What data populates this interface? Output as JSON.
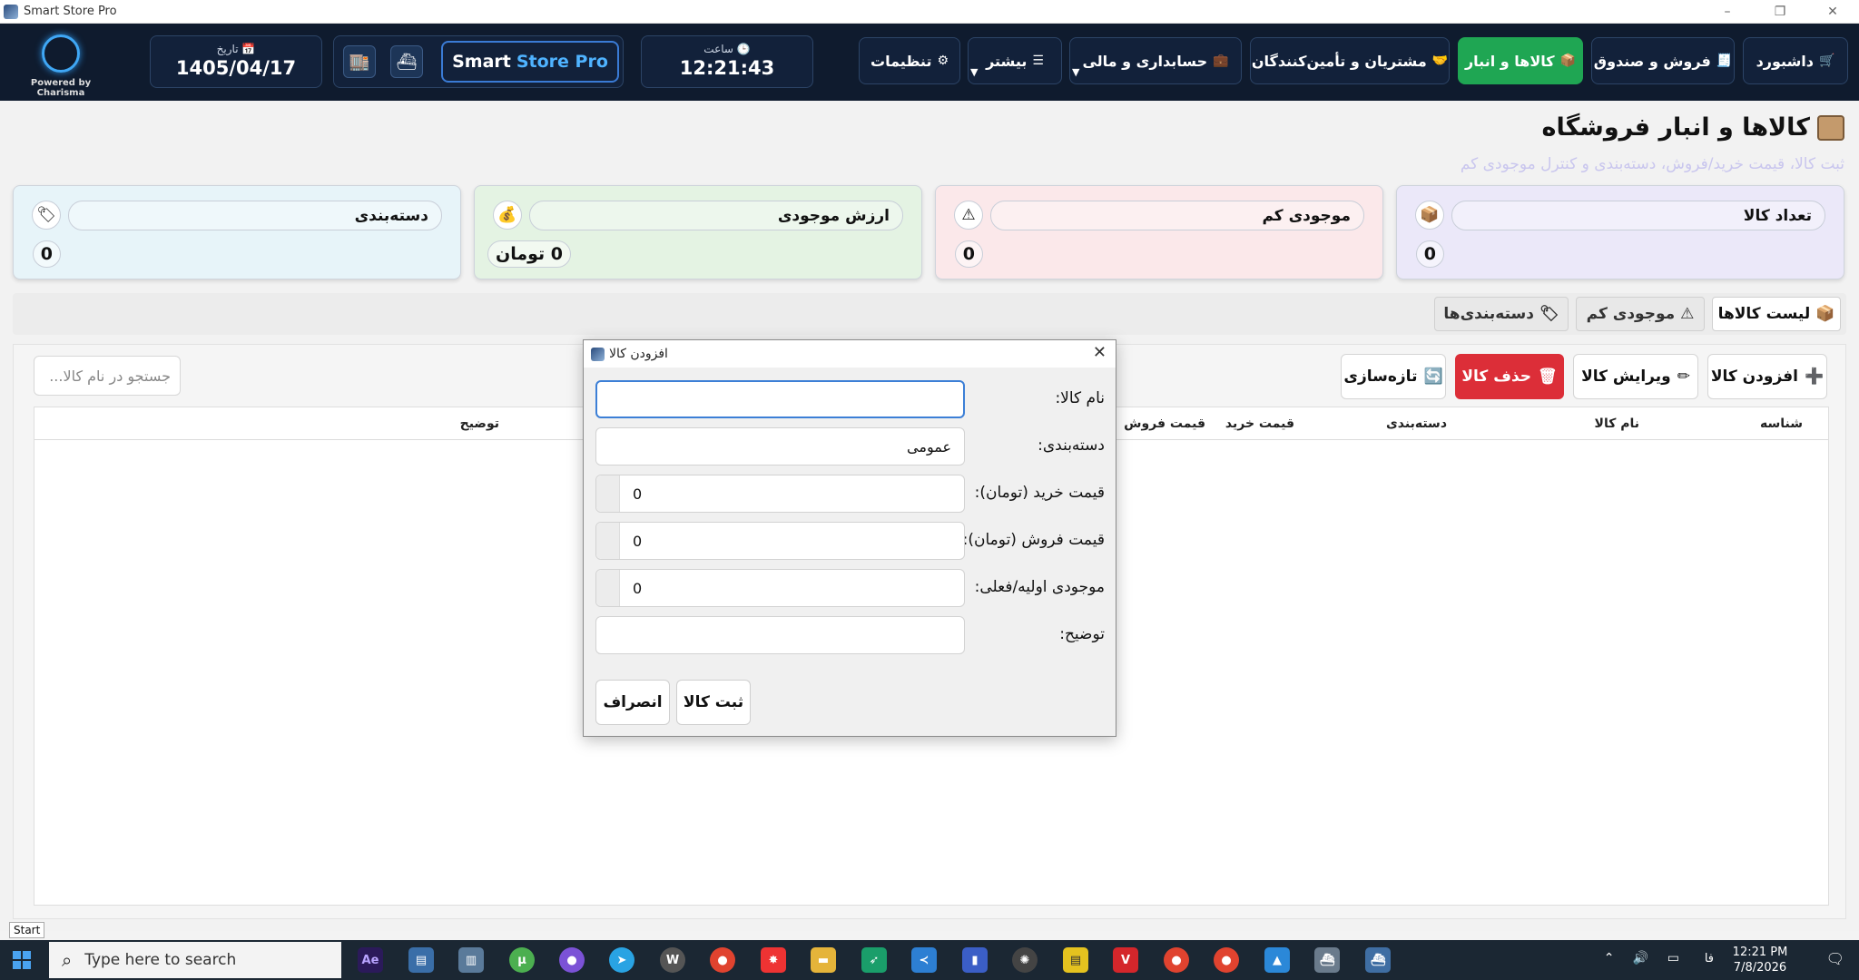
{
  "window": {
    "title": "Smart Store Pro",
    "controls": [
      "–",
      "❐",
      "✕"
    ]
  },
  "header": {
    "logo_caption": "Powered by Charisma",
    "date_label": "تاریخ 📅",
    "date_value": "1405/04/17",
    "brand_main": "Smart",
    "brand_accent": "Store Pro",
    "clock_label": "ساعت 🕒",
    "clock_value": "12:21:43",
    "nav": [
      {
        "label": "داشبورد",
        "icon": "🛒"
      },
      {
        "label": "فروش و صندوق",
        "icon": "🧾"
      },
      {
        "label": "کالاها و انبار",
        "icon": "📦"
      },
      {
        "label": "مشتریان و تأمین‌کنندگان",
        "icon": "🤝"
      },
      {
        "label": "حسابداری و مالی",
        "icon": "💼"
      },
      {
        "label": "بیشتر",
        "icon": "☰"
      },
      {
        "label": "تنظیمات",
        "icon": "⚙"
      }
    ],
    "caret": "▼"
  },
  "page": {
    "title": "کالاها و انبار فروشگاه",
    "subtitle": "ثبت کالا، قیمت خرید/فروش، دسته‌بندی و کنترل موجودی کم"
  },
  "cards": [
    {
      "label": "تعداد کالا",
      "value": "0",
      "icon": "📦"
    },
    {
      "label": "موجودی کم",
      "value": "0",
      "icon": "⚠"
    },
    {
      "label": "ارزش موجودی",
      "value": "0 تومان",
      "icon": "💰"
    },
    {
      "label": "دسته‌بندی",
      "value": "0",
      "icon": "🏷"
    }
  ],
  "tabs": [
    {
      "label": "لیست کالاها",
      "icon": "📦"
    },
    {
      "label": "موجودی کم",
      "icon": "⚠"
    },
    {
      "label": "دسته‌بندی‌ها",
      "icon": "🏷"
    }
  ],
  "toolbar": {
    "add": "افزودن کالا",
    "add_icon": "➕",
    "edit": "ویرایش کالا",
    "edit_icon": "✏",
    "delete": "حذف کالا",
    "delete_icon": "🗑",
    "refresh": "تازه‌سازی",
    "refresh_icon": "🔄",
    "search_placeholder": "جستجو در نام کالا..."
  },
  "table": {
    "columns": [
      "شناسه",
      "نام کالا",
      "دسته‌بندی",
      "قیمت خرید",
      "قیمت فروش",
      "توضیح"
    ]
  },
  "dialog": {
    "title": "افزودن کالا",
    "close": "✕",
    "fields": {
      "name_label": "نام کالا:",
      "name_value": "",
      "category_label": "دسته‌بندی:",
      "category_value": "عمومی",
      "buy_label": "قیمت خرید (تومان):",
      "buy_value": "0",
      "sell_label": "قیمت فروش (تومان):",
      "sell_value": "0",
      "stock_label": "موجودی اولیه/فعلی:",
      "stock_value": "0",
      "desc_label": "توضیح:",
      "desc_value": ""
    },
    "submit": "ثبت کالا",
    "cancel": "انصراف"
  },
  "start_tooltip": "Start",
  "taskbar": {
    "search_placeholder": "Type here to search",
    "lang": "فا",
    "time": "12:21 PM",
    "date": "7/8/2026"
  },
  "colors": {
    "header_bg": "#0f1b2e",
    "active_nav": "#1fa653",
    "danger": "#dc2e38",
    "accent": "#4fb3ff"
  }
}
